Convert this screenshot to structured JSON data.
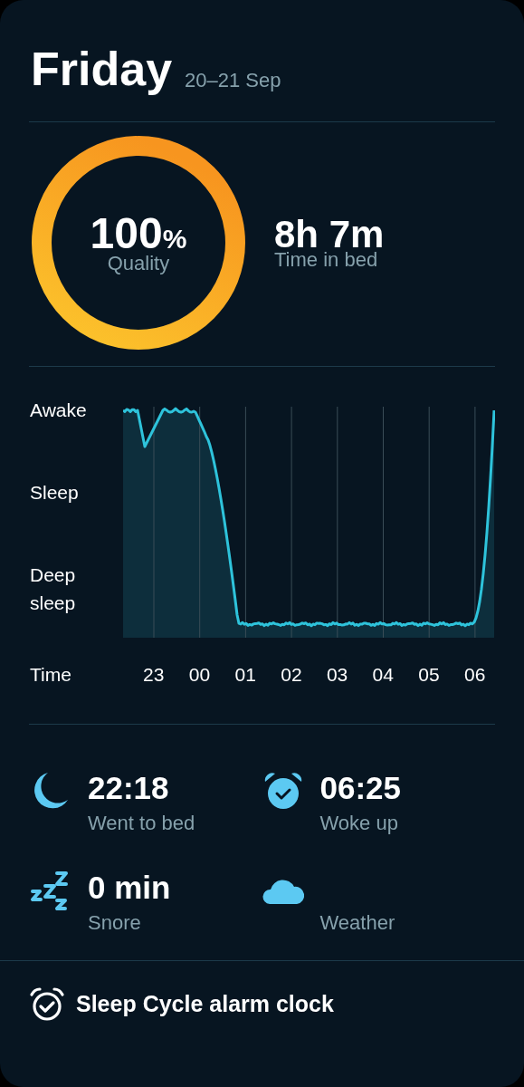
{
  "header": {
    "title": "Friday",
    "date": "20–21 Sep"
  },
  "summary": {
    "quality": {
      "value": "100",
      "unit": "%",
      "label": "Quality"
    },
    "time_in_bed": {
      "value": "8h 7m",
      "label": "Time in bed"
    }
  },
  "sleep_graph": {
    "y_labels": [
      "Awake",
      "Sleep",
      "Deep sleep"
    ],
    "x_title": "Time",
    "x_labels": [
      "23",
      "00",
      "01",
      "02",
      "03",
      "04",
      "05",
      "06"
    ]
  },
  "stats": [
    {
      "kind": "bedtime",
      "value": "22:18",
      "label": "Went to bed"
    },
    {
      "kind": "wake",
      "value": "06:25",
      "label": "Woke up"
    },
    {
      "kind": "snore",
      "value": "0 min",
      "label": "Snore"
    },
    {
      "kind": "weather",
      "label": "Weather"
    }
  ],
  "footer": {
    "label": "Sleep Cycle alarm clock"
  }
}
